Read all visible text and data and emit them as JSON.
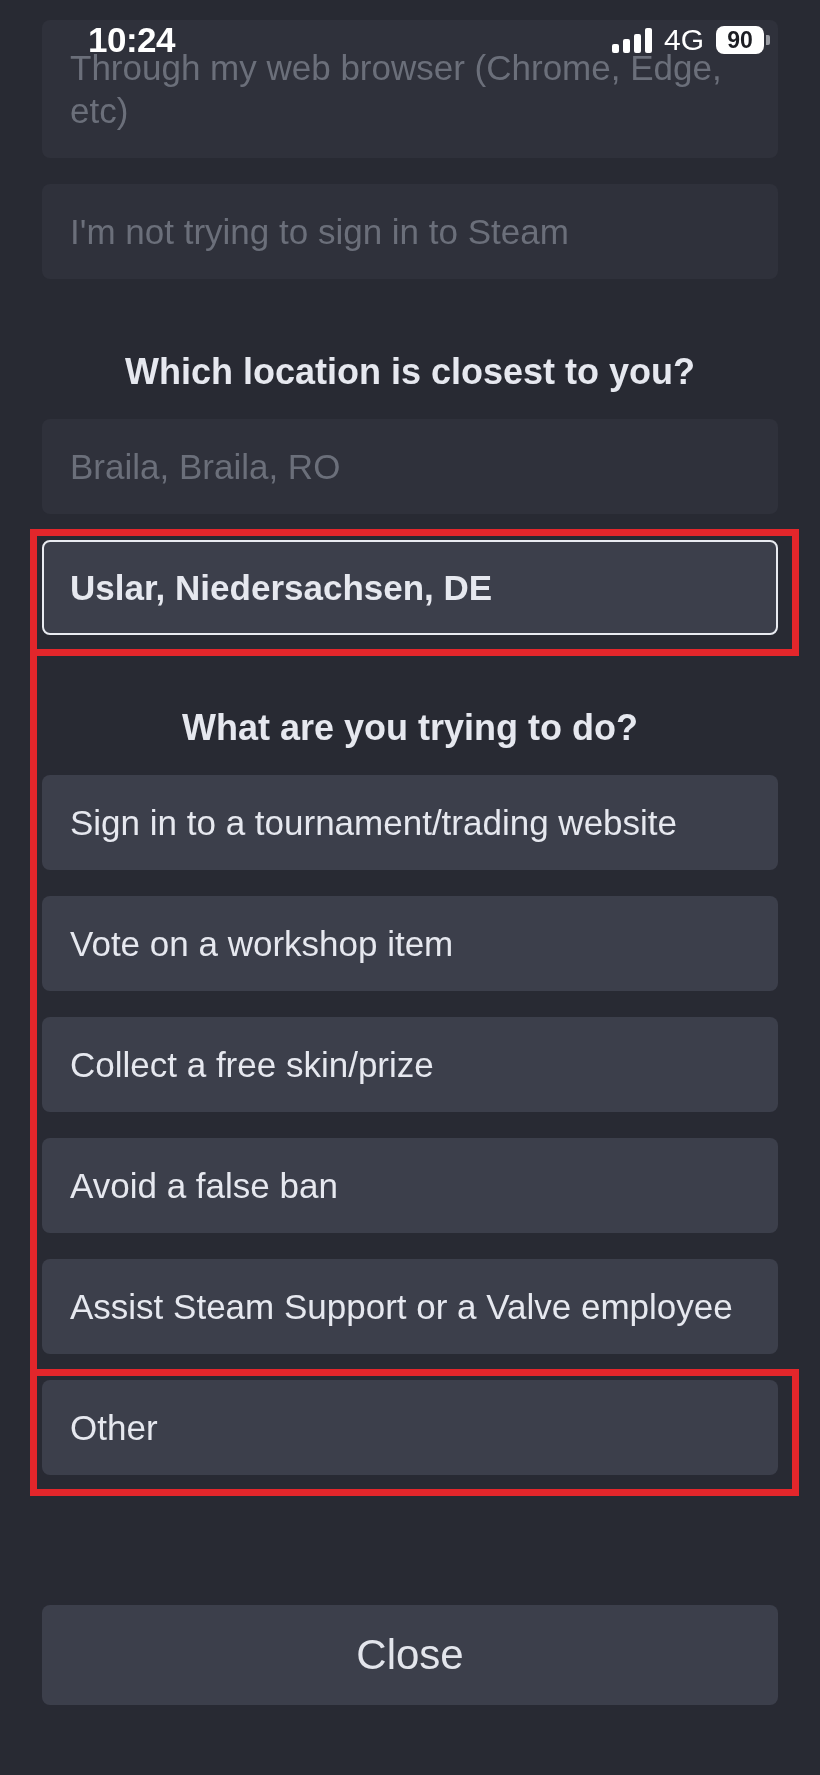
{
  "status_bar": {
    "time": "10:24",
    "network": "4G",
    "battery": "90"
  },
  "sign_in_options": [
    {
      "label": "Through my web browser (Chrome, Edge, etc)",
      "selected": false,
      "disabled": true
    },
    {
      "label": "I'm not trying to sign in to Steam",
      "selected": false,
      "disabled": true
    }
  ],
  "location_section": {
    "title": "Which location is closest to you?",
    "options": [
      {
        "label": "Braila, Braila, RO",
        "selected": false,
        "disabled": true,
        "highlighted": false
      },
      {
        "label": "Uslar, Niedersachsen, DE",
        "selected": true,
        "disabled": false,
        "highlighted": true
      }
    ]
  },
  "goal_section": {
    "title": "What are you trying to do?",
    "bracket_line": true,
    "options": [
      {
        "label": "Sign in to a tournament/trading website",
        "selected": false,
        "disabled": false,
        "highlighted": false
      },
      {
        "label": "Vote on a workshop item",
        "selected": false,
        "disabled": false,
        "highlighted": false
      },
      {
        "label": "Collect a free skin/prize",
        "selected": false,
        "disabled": false,
        "highlighted": false
      },
      {
        "label": "Avoid a false ban",
        "selected": false,
        "disabled": false,
        "highlighted": false
      },
      {
        "label": "Assist Steam Support or a Valve employee",
        "selected": false,
        "disabled": false,
        "highlighted": false
      },
      {
        "label": "Other",
        "selected": false,
        "disabled": false,
        "highlighted": true
      }
    ]
  },
  "close_button": {
    "label": "Close"
  }
}
